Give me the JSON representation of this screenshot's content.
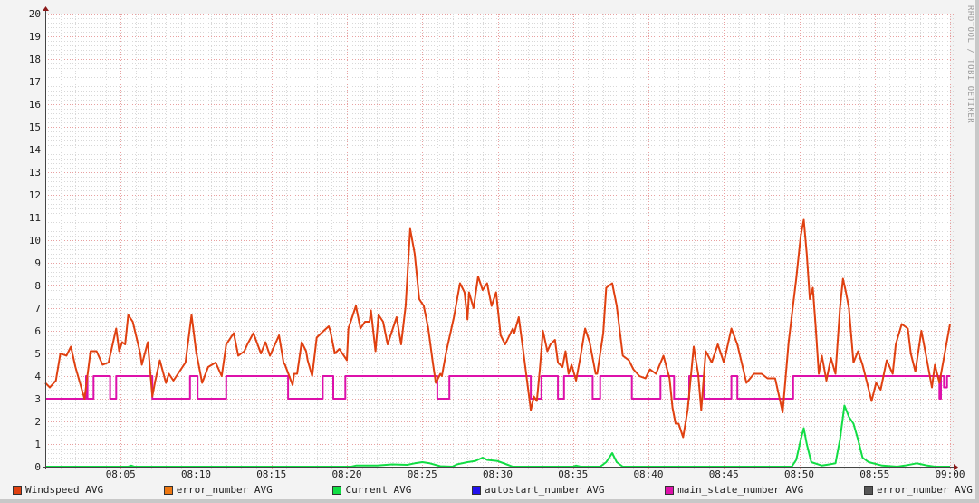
{
  "watermark": "RRDTOOL / TOBI OETIKER",
  "chart_data": {
    "type": "line",
    "title": "",
    "xlabel": "",
    "ylabel": "",
    "x_unit": "minutes after 08:00",
    "xlim": [
      0,
      60
    ],
    "ylim": [
      0,
      20
    ],
    "grid": true,
    "legend_placement": "bottom",
    "yticks": [
      "0",
      "1",
      "2",
      "3",
      "4",
      "5",
      "6",
      "7",
      "8",
      "9",
      "10",
      "11",
      "12",
      "13",
      "14",
      "15",
      "16",
      "17",
      "18",
      "19",
      "20"
    ],
    "xticks": [
      {
        "m": 5,
        "label": "08:05"
      },
      {
        "m": 10,
        "label": "08:10"
      },
      {
        "m": 15,
        "label": "08:15"
      },
      {
        "m": 20,
        "label": "08:20"
      },
      {
        "m": 25,
        "label": "08:25"
      },
      {
        "m": 30,
        "label": "08:30"
      },
      {
        "m": 35,
        "label": "08:35"
      },
      {
        "m": 40,
        "label": "08:40"
      },
      {
        "m": 45,
        "label": "08:45"
      },
      {
        "m": 50,
        "label": "08:50"
      },
      {
        "m": 55,
        "label": "08:55"
      },
      {
        "m": 60,
        "label": "09:00"
      }
    ],
    "legend": [
      {
        "label": "Windspeed AVG",
        "color": "#e04010"
      },
      {
        "label": "error_number AVG",
        "color": "#ee7711"
      },
      {
        "label": "Current AVG",
        "color": "#11dd44"
      },
      {
        "label": "autostart_number AVG",
        "color": "#2211ee"
      },
      {
        "label": "main_state_number AVG",
        "color": "#dd11aa"
      },
      {
        "label": "error_number AVG",
        "color": "#555555"
      }
    ],
    "series": [
      {
        "name": "Windspeed AVG",
        "color": "#e04010",
        "step": false,
        "points": [
          [
            0,
            3.7
          ],
          [
            0.3,
            3.5
          ],
          [
            0.7,
            3.8
          ],
          [
            1.0,
            5.0
          ],
          [
            1.4,
            4.9
          ],
          [
            1.7,
            5.3
          ],
          [
            2.0,
            4.4
          ],
          [
            2.6,
            3.0
          ],
          [
            3.0,
            5.1
          ],
          [
            3.4,
            5.1
          ],
          [
            3.8,
            4.5
          ],
          [
            4.2,
            4.6
          ],
          [
            4.7,
            6.1
          ],
          [
            4.9,
            5.1
          ],
          [
            5.1,
            5.5
          ],
          [
            5.3,
            5.4
          ],
          [
            5.5,
            6.7
          ],
          [
            5.8,
            6.4
          ],
          [
            6.3,
            5.0
          ],
          [
            6.4,
            4.5
          ],
          [
            6.8,
            5.5
          ],
          [
            7.1,
            3.1
          ],
          [
            7.3,
            3.8
          ],
          [
            7.6,
            4.7
          ],
          [
            8.0,
            3.7
          ],
          [
            8.2,
            4.1
          ],
          [
            8.5,
            3.8
          ],
          [
            8.8,
            4.1
          ],
          [
            9.3,
            4.6
          ],
          [
            9.7,
            6.7
          ],
          [
            10.0,
            5.1
          ],
          [
            10.4,
            3.7
          ],
          [
            10.8,
            4.4
          ],
          [
            11.3,
            4.6
          ],
          [
            11.7,
            4.0
          ],
          [
            12.0,
            5.4
          ],
          [
            12.5,
            5.9
          ],
          [
            12.8,
            4.9
          ],
          [
            13.2,
            5.1
          ],
          [
            13.4,
            5.4
          ],
          [
            13.8,
            5.9
          ],
          [
            14.3,
            5.0
          ],
          [
            14.6,
            5.5
          ],
          [
            14.9,
            4.9
          ],
          [
            15.5,
            5.8
          ],
          [
            15.8,
            4.6
          ],
          [
            15.9,
            4.5
          ],
          [
            16.4,
            3.6
          ],
          [
            16.5,
            4.1
          ],
          [
            16.7,
            4.1
          ],
          [
            17.0,
            5.5
          ],
          [
            17.3,
            5.1
          ],
          [
            17.4,
            4.7
          ],
          [
            17.7,
            4.0
          ],
          [
            18.0,
            5.7
          ],
          [
            18.3,
            5.9
          ],
          [
            18.8,
            6.2
          ],
          [
            18.9,
            6.0
          ],
          [
            19.2,
            5.0
          ],
          [
            19.5,
            5.2
          ],
          [
            20.0,
            4.7
          ],
          [
            20.1,
            6.1
          ],
          [
            20.6,
            7.1
          ],
          [
            20.9,
            6.1
          ],
          [
            21.2,
            6.4
          ],
          [
            21.5,
            6.4
          ],
          [
            21.6,
            6.9
          ],
          [
            21.9,
            5.1
          ],
          [
            22.1,
            6.7
          ],
          [
            22.4,
            6.4
          ],
          [
            22.7,
            5.4
          ],
          [
            23.3,
            6.6
          ],
          [
            23.6,
            5.4
          ],
          [
            23.9,
            7.1
          ],
          [
            24.2,
            10.5
          ],
          [
            24.5,
            9.4
          ],
          [
            24.8,
            7.4
          ],
          [
            25.1,
            7.1
          ],
          [
            25.4,
            6.1
          ],
          [
            25.7,
            4.6
          ],
          [
            25.9,
            3.7
          ],
          [
            26.2,
            4.1
          ],
          [
            26.3,
            4.0
          ],
          [
            26.6,
            5.1
          ],
          [
            27.1,
            6.6
          ],
          [
            27.5,
            8.1
          ],
          [
            27.8,
            7.7
          ],
          [
            28.0,
            6.5
          ],
          [
            28.1,
            7.7
          ],
          [
            28.4,
            7.0
          ],
          [
            28.7,
            8.4
          ],
          [
            29.0,
            7.8
          ],
          [
            29.3,
            8.1
          ],
          [
            29.6,
            7.1
          ],
          [
            29.9,
            7.7
          ],
          [
            30.2,
            5.8
          ],
          [
            30.5,
            5.4
          ],
          [
            31.0,
            6.1
          ],
          [
            31.1,
            5.9
          ],
          [
            31.4,
            6.6
          ],
          [
            31.7,
            5.1
          ],
          [
            32.2,
            2.5
          ],
          [
            32.4,
            3.1
          ],
          [
            32.6,
            2.9
          ],
          [
            32.8,
            4.3
          ],
          [
            33.0,
            6.0
          ],
          [
            33.3,
            5.1
          ],
          [
            33.5,
            5.4
          ],
          [
            33.8,
            5.6
          ],
          [
            34.0,
            4.6
          ],
          [
            34.3,
            4.4
          ],
          [
            34.5,
            5.1
          ],
          [
            34.7,
            4.1
          ],
          [
            34.9,
            4.5
          ],
          [
            35.2,
            3.8
          ],
          [
            35.5,
            4.9
          ],
          [
            35.8,
            6.1
          ],
          [
            36.1,
            5.5
          ],
          [
            36.5,
            4.1
          ],
          [
            36.6,
            4.1
          ],
          [
            37.0,
            5.9
          ],
          [
            37.2,
            7.9
          ],
          [
            37.6,
            8.1
          ],
          [
            37.9,
            7.1
          ],
          [
            38.3,
            4.9
          ],
          [
            38.7,
            4.7
          ],
          [
            39.0,
            4.3
          ],
          [
            39.4,
            4.0
          ],
          [
            39.8,
            3.9
          ],
          [
            40.1,
            4.3
          ],
          [
            40.5,
            4.1
          ],
          [
            41.0,
            4.9
          ],
          [
            41.4,
            3.9
          ],
          [
            41.6,
            2.6
          ],
          [
            41.8,
            1.9
          ],
          [
            42.0,
            1.9
          ],
          [
            42.3,
            1.3
          ],
          [
            42.6,
            2.5
          ],
          [
            43.0,
            5.3
          ],
          [
            43.3,
            4.1
          ],
          [
            43.5,
            2.5
          ],
          [
            43.8,
            5.1
          ],
          [
            44.2,
            4.6
          ],
          [
            44.6,
            5.4
          ],
          [
            45.0,
            4.6
          ],
          [
            45.5,
            6.1
          ],
          [
            45.9,
            5.4
          ],
          [
            46.5,
            3.7
          ],
          [
            47.0,
            4.1
          ],
          [
            47.5,
            4.1
          ],
          [
            47.9,
            3.9
          ],
          [
            48.4,
            3.9
          ],
          [
            48.9,
            2.4
          ],
          [
            49.3,
            5.5
          ],
          [
            49.8,
            8.3
          ],
          [
            50.1,
            10.2
          ],
          [
            50.3,
            10.9
          ],
          [
            50.5,
            9.4
          ],
          [
            50.7,
            7.4
          ],
          [
            50.9,
            7.9
          ],
          [
            51.1,
            6.1
          ],
          [
            51.3,
            4.1
          ],
          [
            51.5,
            4.9
          ],
          [
            51.8,
            3.8
          ],
          [
            52.1,
            4.8
          ],
          [
            52.4,
            4.1
          ],
          [
            52.7,
            7.0
          ],
          [
            52.9,
            8.3
          ],
          [
            53.1,
            7.7
          ],
          [
            53.3,
            7.0
          ],
          [
            53.6,
            4.6
          ],
          [
            53.9,
            5.1
          ],
          [
            54.2,
            4.5
          ],
          [
            54.8,
            2.9
          ],
          [
            55.1,
            3.7
          ],
          [
            55.4,
            3.4
          ],
          [
            55.8,
            4.7
          ],
          [
            56.2,
            4.1
          ],
          [
            56.4,
            5.4
          ],
          [
            56.8,
            6.3
          ],
          [
            57.2,
            6.1
          ],
          [
            57.4,
            5.0
          ],
          [
            57.7,
            4.2
          ],
          [
            58.1,
            6.0
          ],
          [
            58.5,
            4.6
          ],
          [
            58.8,
            3.5
          ],
          [
            59.0,
            4.5
          ],
          [
            59.3,
            3.7
          ],
          [
            60.0,
            6.3
          ]
        ]
      },
      {
        "name": "main_state_number AVG",
        "color": "#dd11aa",
        "step": true,
        "points": [
          [
            0,
            3
          ],
          [
            2.7,
            4
          ],
          [
            2.8,
            3
          ],
          [
            3.2,
            4
          ],
          [
            4.3,
            3
          ],
          [
            4.7,
            4
          ],
          [
            7.1,
            3
          ],
          [
            9.6,
            4
          ],
          [
            10.1,
            3
          ],
          [
            12.0,
            4
          ],
          [
            16.1,
            3
          ],
          [
            18.4,
            4
          ],
          [
            19.1,
            3
          ],
          [
            19.9,
            4
          ],
          [
            26.0,
            3
          ],
          [
            26.8,
            4
          ],
          [
            32.2,
            3
          ],
          [
            32.9,
            4
          ],
          [
            34.0,
            3
          ],
          [
            34.4,
            4
          ],
          [
            36.3,
            3
          ],
          [
            36.8,
            4
          ],
          [
            38.9,
            3
          ],
          [
            40.8,
            4
          ],
          [
            41.7,
            3
          ],
          [
            42.7,
            4
          ],
          [
            43.7,
            3
          ],
          [
            45.5,
            4
          ],
          [
            45.9,
            3
          ],
          [
            49.6,
            4
          ],
          [
            59.3,
            3
          ],
          [
            59.4,
            4
          ],
          [
            59.6,
            3.5
          ],
          [
            59.8,
            4
          ],
          [
            60,
            4
          ]
        ]
      },
      {
        "name": "Current AVG",
        "color": "#11dd44",
        "step": false,
        "points": [
          [
            0,
            0
          ],
          [
            5.5,
            0
          ],
          [
            5.7,
            0.05
          ],
          [
            5.9,
            0
          ],
          [
            20.3,
            0
          ],
          [
            20.6,
            0.05
          ],
          [
            22,
            0.05
          ],
          [
            23,
            0.1
          ],
          [
            24,
            0.08
          ],
          [
            24.5,
            0.15
          ],
          [
            25,
            0.2
          ],
          [
            25.5,
            0.15
          ],
          [
            26.2,
            0.02
          ],
          [
            27,
            0
          ],
          [
            27.3,
            0.1
          ],
          [
            28,
            0.2
          ],
          [
            28.5,
            0.25
          ],
          [
            29,
            0.4
          ],
          [
            29.3,
            0.3
          ],
          [
            30,
            0.25
          ],
          [
            30.6,
            0.1
          ],
          [
            31,
            0
          ],
          [
            35,
            0
          ],
          [
            35.2,
            0.05
          ],
          [
            35.5,
            0
          ],
          [
            36.8,
            0
          ],
          [
            37.2,
            0.2
          ],
          [
            37.6,
            0.6
          ],
          [
            37.9,
            0.2
          ],
          [
            38.3,
            0
          ],
          [
            49.5,
            0
          ],
          [
            49.8,
            0.3
          ],
          [
            50.1,
            1.2
          ],
          [
            50.3,
            1.7
          ],
          [
            50.5,
            1.0
          ],
          [
            50.8,
            0.2
          ],
          [
            51.5,
            0.05
          ],
          [
            52,
            0.1
          ],
          [
            52.4,
            0.15
          ],
          [
            52.7,
            1.2
          ],
          [
            53,
            2.7
          ],
          [
            53.3,
            2.2
          ],
          [
            53.6,
            1.9
          ],
          [
            53.9,
            1.2
          ],
          [
            54.2,
            0.4
          ],
          [
            54.6,
            0.2
          ],
          [
            55.5,
            0.05
          ],
          [
            56.5,
            0
          ],
          [
            57,
            0.05
          ],
          [
            57.8,
            0.15
          ],
          [
            58.5,
            0.05
          ],
          [
            59,
            0
          ],
          [
            60,
            0
          ]
        ]
      }
    ]
  }
}
